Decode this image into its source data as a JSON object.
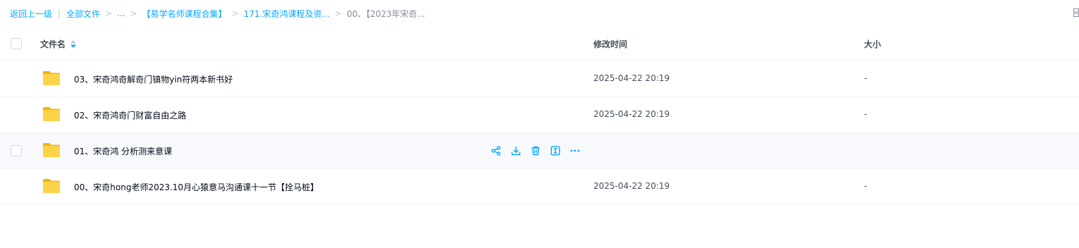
{
  "breadcrumb": {
    "back": "返回上一级",
    "separator": "|",
    "all_files": "全部文件",
    "ellipsis": "...",
    "crumb1": "【易学名师课程合集】",
    "crumb2": "171.宋奇鸿课程及资...",
    "current": "00、【2023年宋奇..."
  },
  "header": {
    "name": "文件名",
    "time": "修改时间",
    "size": "大小"
  },
  "files": [
    {
      "name": "03、宋奇鸿奇解奇门镇物yin符两本新书好",
      "time": "2025-04-22 20:19",
      "size": "-"
    },
    {
      "name": "02、宋奇鸿奇门财富自由之路",
      "time": "2025-04-22 20:19",
      "size": "-"
    },
    {
      "name": "01、宋奇鸿 分析测来意课",
      "time": "",
      "size": ""
    },
    {
      "name": "00、宋奇hong老师2023.10月心猿意马沟通课十一节【拴马桩】",
      "time": "2025-04-22 20:19",
      "size": "-"
    }
  ],
  "icons": {
    "folder": "folder-icon",
    "share": "share-icon",
    "download": "download-icon",
    "delete": "trash-icon",
    "rename": "rename-icon",
    "more": "more-icon"
  },
  "colors": {
    "accent": "#06a7ff",
    "folder": "#ffc633",
    "text": "#03081a",
    "muted": "#454d5a"
  }
}
